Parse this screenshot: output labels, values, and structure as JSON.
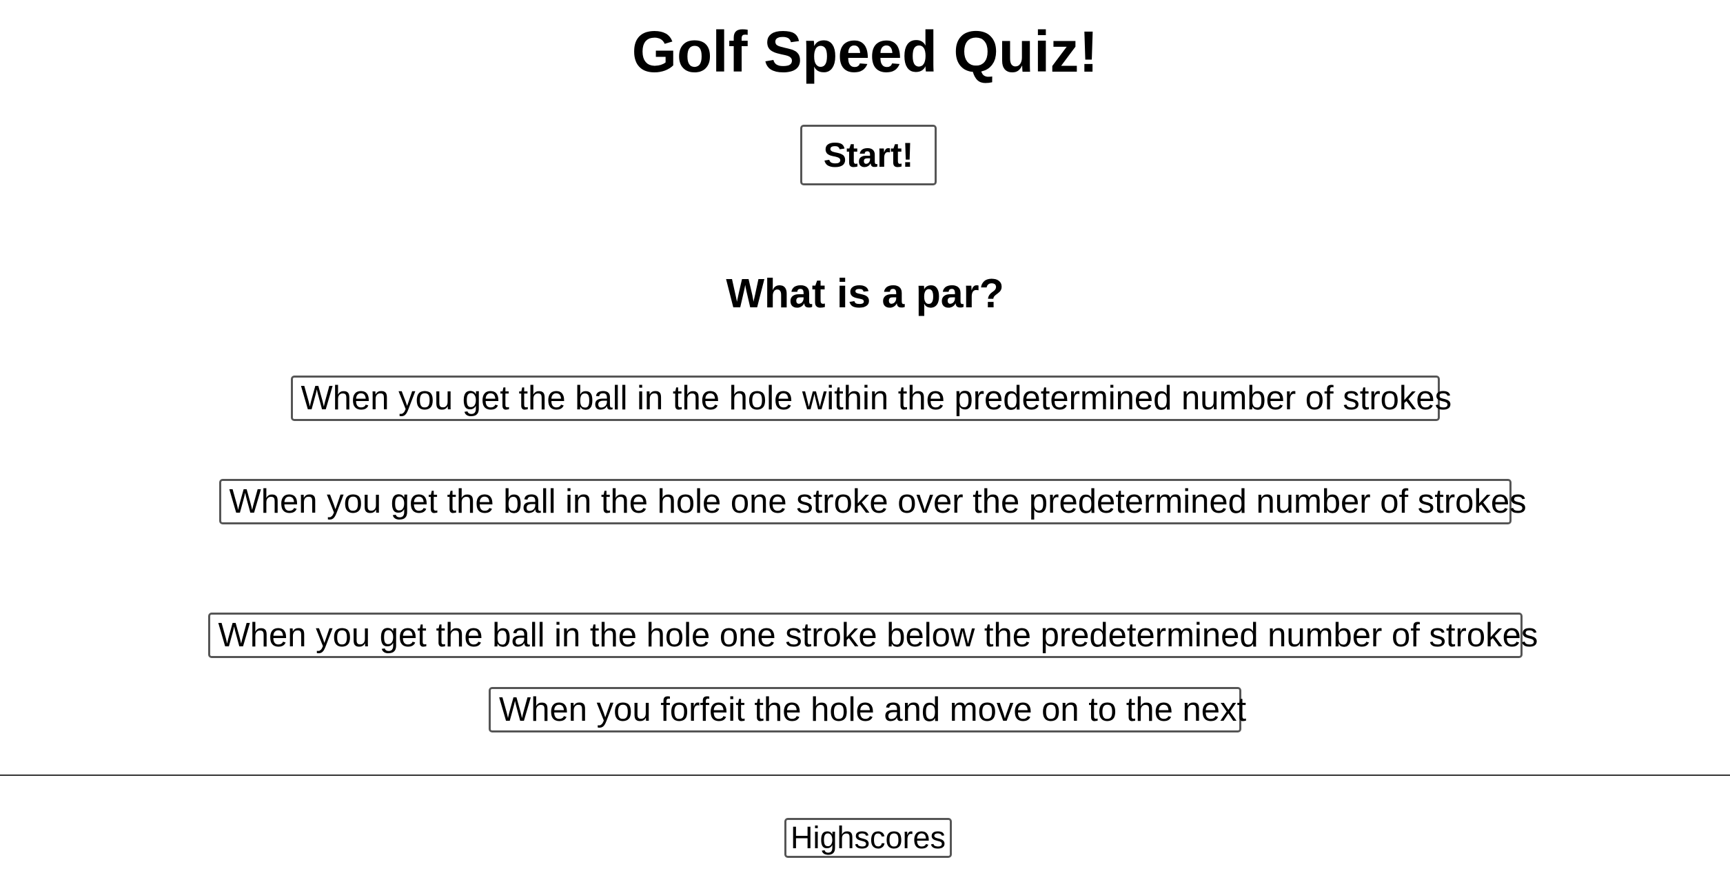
{
  "header": {
    "title": "Golf Speed Quiz!"
  },
  "controls": {
    "start_label": "Start!"
  },
  "quiz": {
    "question": "What is a par?",
    "answers": [
      {
        "label": "When you get the ball in the hole within the predetermined number of strokes"
      },
      {
        "label": "When you get the ball in the hole one stroke over the predetermined number of strokes"
      },
      {
        "label": "When you get the ball in the hole one stroke below the predetermined number of strokes"
      },
      {
        "label": "When you forfeit the hole and move on to the next"
      }
    ]
  },
  "footer": {
    "highscores_label": "Highscores"
  },
  "colors": {
    "background": "#ffffff",
    "text": "#000000",
    "button_border": "#555555",
    "divider": "#333333"
  }
}
